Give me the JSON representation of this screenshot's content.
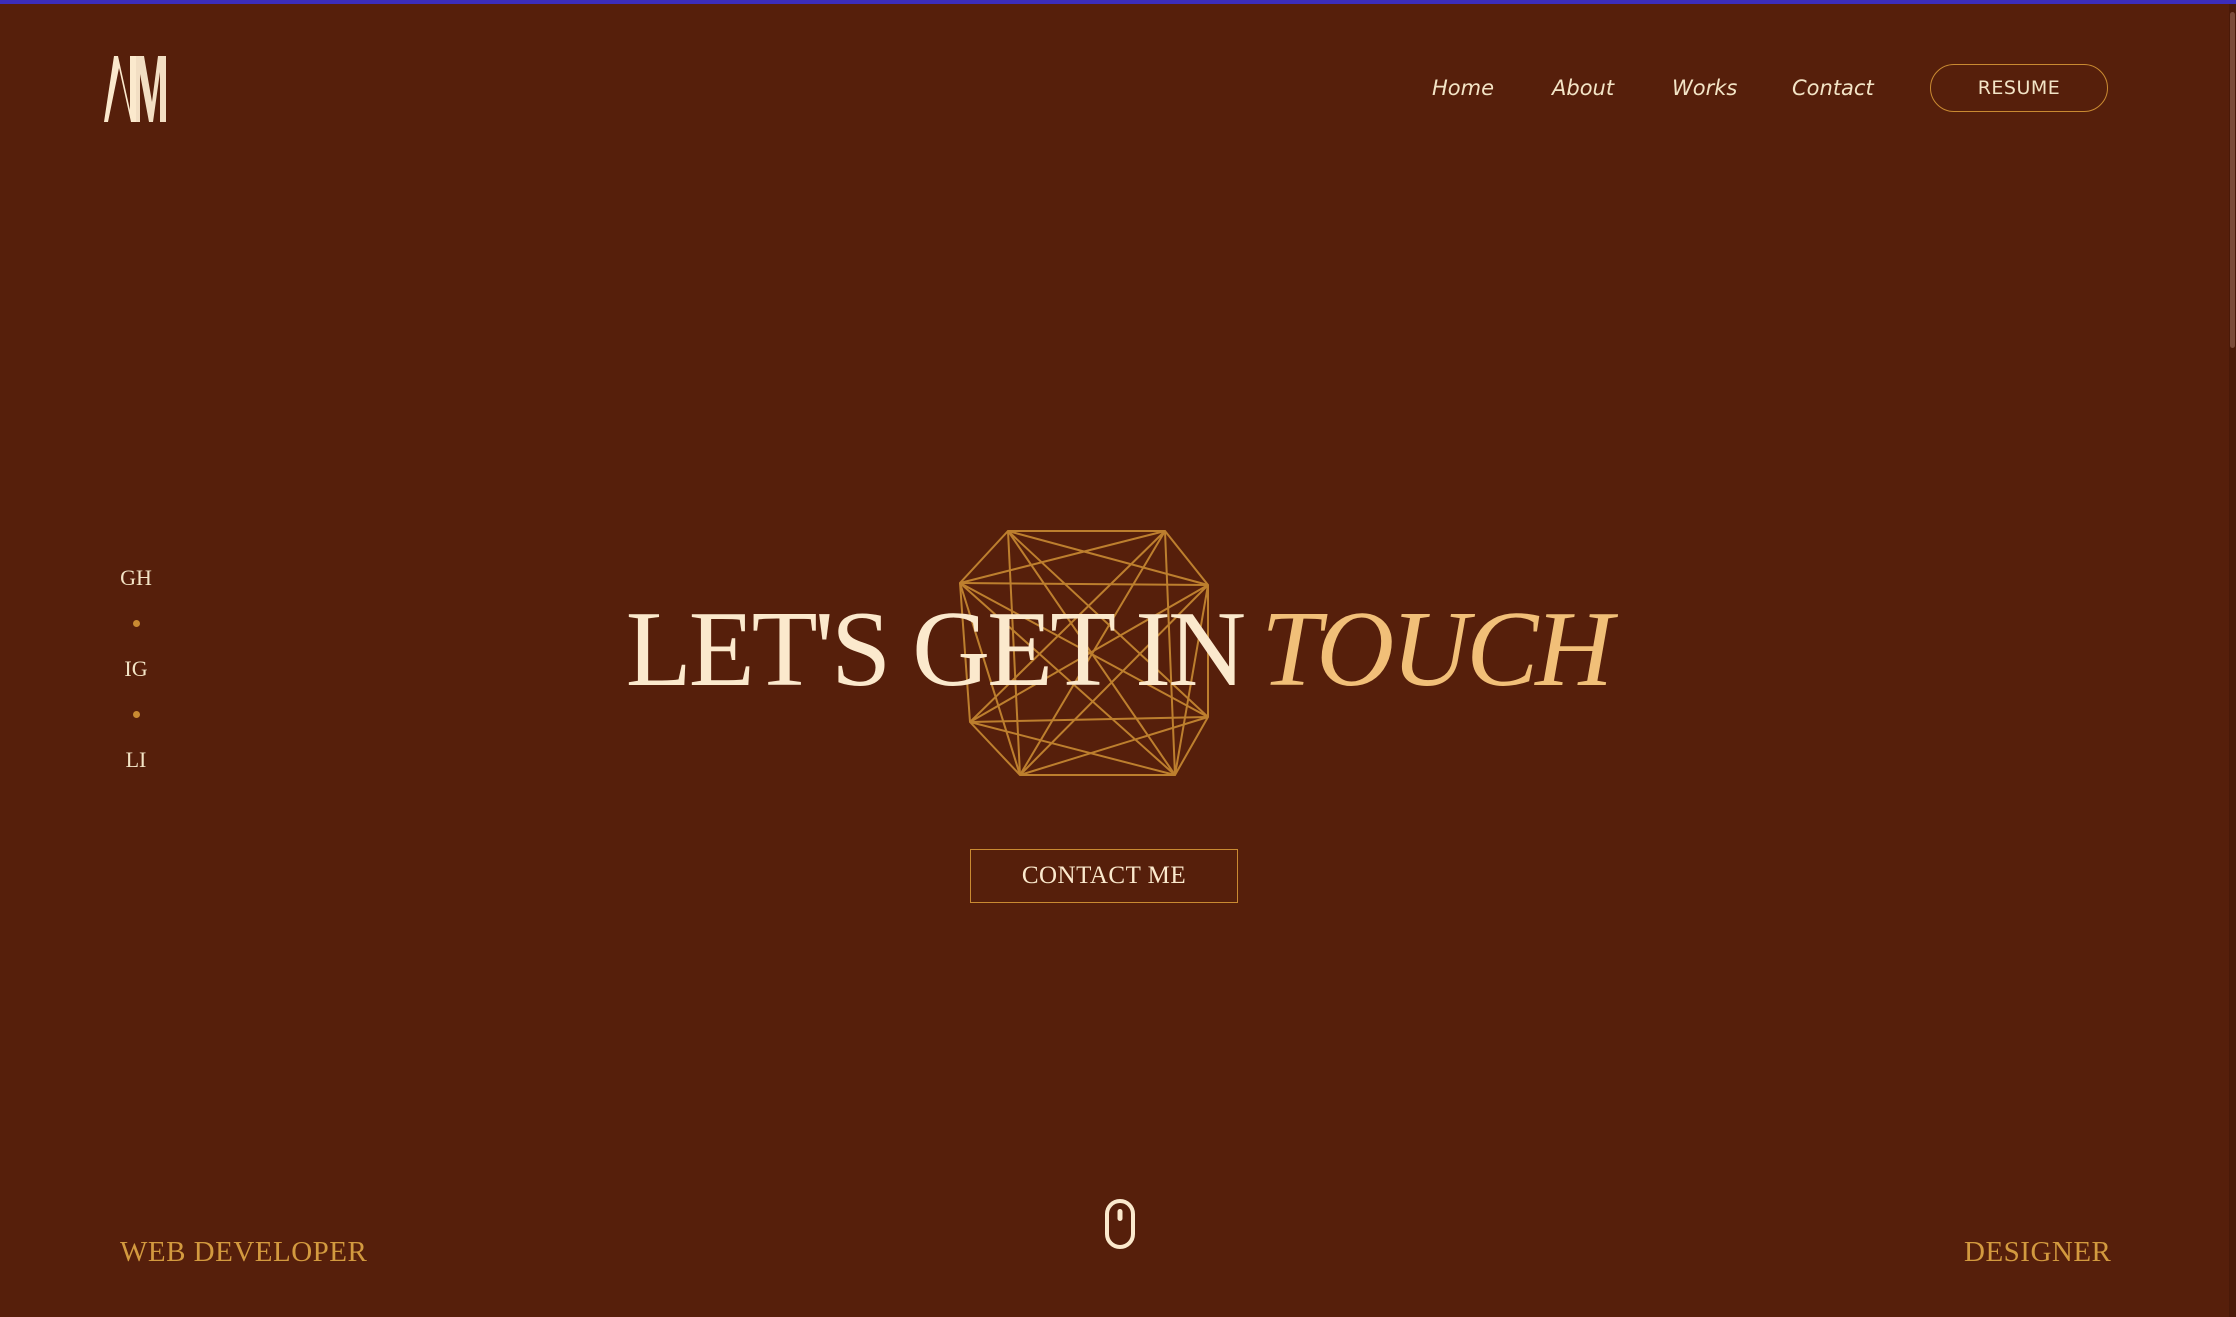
{
  "colors": {
    "background": "#561f0b",
    "accent": "#c98a32",
    "text_light": "#fbe9cd",
    "highlight": "#f1bf78"
  },
  "header": {
    "logo_text": "NM",
    "nav": [
      {
        "label": "Home"
      },
      {
        "label": "About"
      },
      {
        "label": "Works"
      },
      {
        "label": "Contact"
      }
    ],
    "resume_label": "RESUME"
  },
  "social": {
    "links": [
      {
        "label": "GH"
      },
      {
        "label": "IG"
      },
      {
        "label": "LI"
      }
    ]
  },
  "hero": {
    "title_main": "LET'S GET IN",
    "title_accent": "TOUCH",
    "contact_label": "CONTACT ME"
  },
  "footer": {
    "left_role": "WEB DEVELOPER",
    "right_role": "DESIGNER",
    "scroll_icon": "mouse-icon"
  }
}
